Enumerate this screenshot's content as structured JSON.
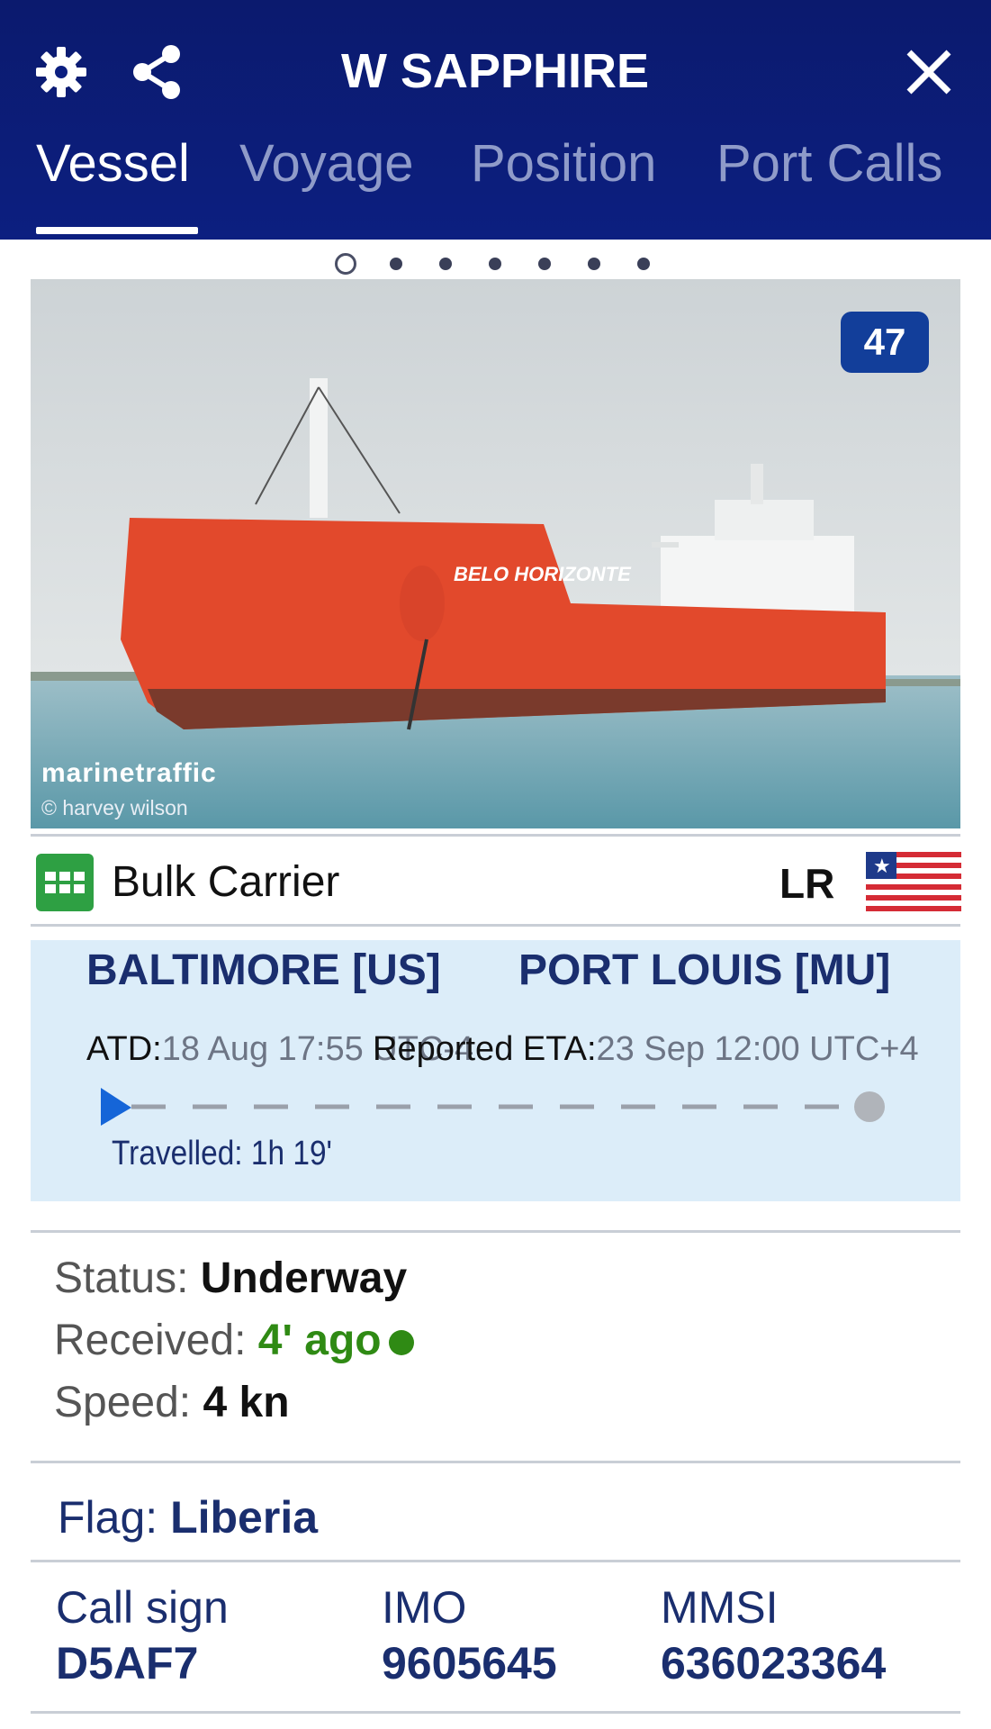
{
  "header": {
    "title": "W SAPPHIRE",
    "tabs": [
      {
        "label": "Vessel",
        "active": true
      },
      {
        "label": "Voyage",
        "active": false
      },
      {
        "label": "Position",
        "active": false
      },
      {
        "label": "Port Calls",
        "active": false
      }
    ]
  },
  "carousel": {
    "count": 7,
    "active_index": 0
  },
  "photo": {
    "count_badge": "47",
    "ship_name": "BELO HORIZONTE",
    "watermark": "marinetraffic",
    "credit": "© harvey wilson"
  },
  "vessel": {
    "type": "Bulk Carrier",
    "flag_code": "LR"
  },
  "route": {
    "departure_port": "BALTIMORE [US]",
    "arrival_port": "PORT LOUIS [MU]",
    "atd_label": "ATD:",
    "atd_value": "18 Aug 17:55 UTC-4",
    "eta_label": "Reported ETA:",
    "eta_value": "23 Sep 12:00 UTC+4",
    "travelled": "Travelled: 1h 19'"
  },
  "status": {
    "status_label": "Status:",
    "status_value": "Underway",
    "received_label": "Received:",
    "received_value": "4' ago",
    "speed_label": "Speed:",
    "speed_value": "4 kn"
  },
  "flag": {
    "label": "Flag:",
    "value": "Liberia"
  },
  "ids": {
    "call_sign_label": "Call sign",
    "call_sign_value": "D5AF7",
    "imo_label": "IMO",
    "imo_value": "9605645",
    "mmsi_label": "MMSI",
    "mmsi_value": "636023364"
  },
  "colors": {
    "header_bg": "#0c1f80",
    "route_bg": "#dcedf9",
    "accent_text": "#1a2e6e",
    "received_green": "#2f8a14",
    "type_icon_green": "#2ea043",
    "badge_blue": "#123e9a"
  }
}
